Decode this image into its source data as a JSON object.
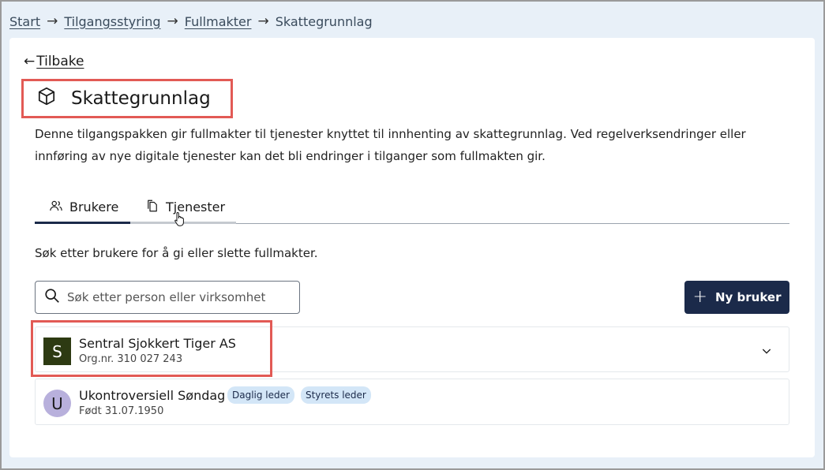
{
  "breadcrumb": {
    "items": [
      "Start",
      "Tilgangsstyring",
      "Fullmakter"
    ],
    "current": "Skattegrunnlag"
  },
  "back": {
    "arrow": "←",
    "label": "Tilbake"
  },
  "page": {
    "icon": "package-icon",
    "title": "Skattegrunnlag",
    "description": "Denne tilgangspakken gir fullmakter til tjenester knyttet til innhenting av skattegrunnlag. Ved regelverksendringer eller innføring av nye digitale tjenester kan det bli endringer i tilganger som fullmakten gir."
  },
  "tabs": [
    {
      "label": "Brukere",
      "icon": "users-icon",
      "active": true
    },
    {
      "label": "Tjenester",
      "icon": "copy-icon",
      "active": false
    }
  ],
  "hint": "Søk etter brukere for å gi eller slette fullmakter.",
  "search": {
    "placeholder": "Søk etter person eller virksomhet",
    "value": ""
  },
  "new_user_button": {
    "label": "Ny bruker",
    "icon": "plus"
  },
  "users": [
    {
      "initial": "S",
      "name": "Sentral Sjokkert Tiger AS",
      "sub": "Org.nr. 310 027 243",
      "kind": "organization",
      "badges": []
    },
    {
      "initial": "U",
      "name": "Ukontroversiell Søndag",
      "sub": "Født 31.07.1950",
      "kind": "person",
      "badges": [
        "Daglig leder",
        "Styrets leder"
      ]
    }
  ],
  "colors": {
    "primary": "#1b2a4a",
    "highlight": "#e25a55",
    "org_avatar": "#2d3a12",
    "person_avatar": "#b8b0dc",
    "badge_bg": "#d3e6f7"
  }
}
